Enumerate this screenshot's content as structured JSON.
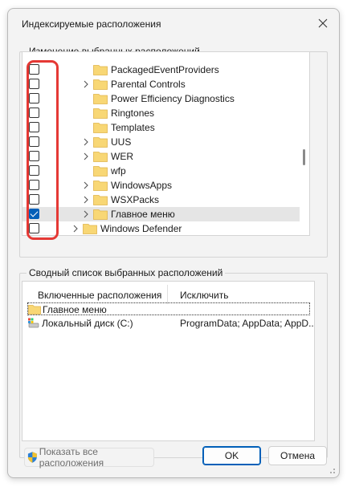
{
  "window": {
    "title": "Индексируемые расположения"
  },
  "locations_group": {
    "legend": "Изменение выбранных расположений",
    "items": [
      {
        "label": "PackagedEventProviders",
        "checked": false,
        "expandable": false
      },
      {
        "label": "Parental Controls",
        "checked": false,
        "expandable": true
      },
      {
        "label": "Power Efficiency Diagnostics",
        "checked": false,
        "expandable": false
      },
      {
        "label": "Ringtones",
        "checked": false,
        "expandable": false
      },
      {
        "label": "Templates",
        "checked": false,
        "expandable": false
      },
      {
        "label": "UUS",
        "checked": false,
        "expandable": true
      },
      {
        "label": "WER",
        "checked": false,
        "expandable": true
      },
      {
        "label": "wfp",
        "checked": false,
        "expandable": false
      },
      {
        "label": "WindowsApps",
        "checked": false,
        "expandable": true
      },
      {
        "label": "WSXPacks",
        "checked": false,
        "expandable": true
      },
      {
        "label": "Главное меню",
        "checked": true,
        "expandable": true,
        "selected": true
      },
      {
        "label": "Windows Defender",
        "checked": false,
        "expandable": true
      }
    ]
  },
  "summary_group": {
    "legend": "Сводный список выбранных расположений",
    "columns": [
      "Включенные расположения",
      "Исключить"
    ],
    "rows": [
      {
        "location": "Главное меню",
        "exclude": "",
        "icon": "folder-icon"
      },
      {
        "location": "Локальный диск (C:)",
        "exclude": "ProgramData; AppData; AppD...",
        "icon": "drive-icon"
      }
    ]
  },
  "buttons": {
    "show_all": "Показать все расположения",
    "ok": "OK",
    "cancel": "Отмена"
  },
  "colors": {
    "accent": "#005fb8",
    "highlight": "#e53935",
    "folder": "#f8d775"
  }
}
